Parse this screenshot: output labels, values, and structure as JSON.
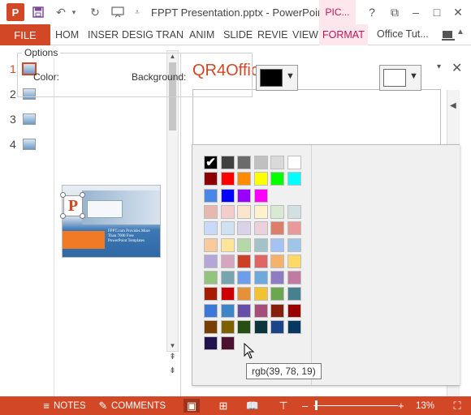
{
  "titlebar": {
    "title": "FPPT Presentation.pptx - PowerPoint",
    "app_icon_letter": "P",
    "context_tab": "PIC...",
    "help": "?",
    "restore": "⧉",
    "minimize": "–",
    "maximize": "□",
    "close": "✕"
  },
  "ribbon": {
    "file": "FILE",
    "tabs": [
      "HOM",
      "INSER",
      "DESIG",
      "TRAN",
      "ANIM",
      "SLIDE",
      "REVIE",
      "VIEW"
    ],
    "active_tab": "FORMAT",
    "account": "Office Tut..."
  },
  "slides": {
    "numbers": [
      "1",
      "2",
      "3",
      "4"
    ],
    "active_index": 0
  },
  "slide_content": {
    "logo_letter": "P",
    "text_lines": [
      "FPPT.com Provides More",
      "Than 7000 Free",
      "PowerPoint Templates"
    ]
  },
  "taskpane": {
    "title": "QR4Office",
    "menu_icon": "▾",
    "close_icon": "✕",
    "options_legend": "Options",
    "color_label": "Color:",
    "background_label": "Background:",
    "color_value": "#000000",
    "background_value": "#ffffff",
    "dropdown_arrow": "▼"
  },
  "palette": {
    "selected_index": 0,
    "rows": [
      [
        "#000000",
        "#404040",
        "#6b6b6b",
        "#c0c0c0",
        "#d9d9d9",
        "#ffffff"
      ],
      [
        "#8b0000",
        "#ff0000",
        "#ff8c00",
        "#ffff00",
        "#00ff00",
        "#00ffff"
      ],
      [
        "#4a86e8",
        "#0000ff",
        "#9900ff",
        "#ff00ff"
      ],
      [
        "#e6b8af",
        "#f4cccc",
        "#fce5cd",
        "#fff2cc",
        "#d9ead3",
        "#d0e0e3"
      ],
      [
        "#c9daf8",
        "#cfe2f3",
        "#d9d2e9",
        "#ead1dc",
        "#dd7e6b",
        "#ea9999"
      ],
      [
        "#f9cb9c",
        "#ffe599",
        "#b6d7a8",
        "#a2c4c9",
        "#a4c2f4",
        "#9fc5e8"
      ],
      [
        "#b4a7d6",
        "#d5a6bd",
        "#cc4125",
        "#e06666",
        "#f6b26b",
        "#ffd966"
      ],
      [
        "#93c47d",
        "#76a5af",
        "#6d9eeb",
        "#6fa8dc",
        "#8e7cc3",
        "#c27ba0"
      ],
      [
        "#a61c00",
        "#cc0000",
        "#e69138",
        "#f1c232",
        "#6aa84f",
        "#45818e"
      ],
      [
        "#3c78d8",
        "#3d85c6",
        "#674ea7",
        "#a64d79",
        "#85200c",
        "#990000"
      ],
      [
        "#783f04",
        "#7f6000",
        "#274e13",
        "#0c343d",
        "#1c4587",
        "#073763"
      ],
      [
        "#20124d",
        "#4c1130"
      ]
    ],
    "tooltip": "rgb(39, 78, 19)"
  },
  "statusbar": {
    "notes": "NOTES",
    "comments": "COMMENTS",
    "zoom_minus": "–",
    "zoom_plus": "+",
    "zoom": "13%",
    "zoom_fraction": 0.02
  }
}
